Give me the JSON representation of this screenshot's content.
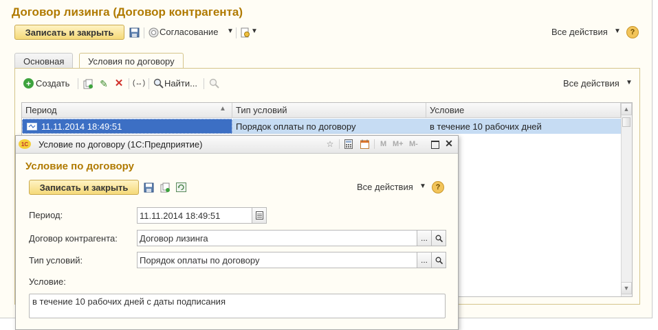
{
  "main": {
    "title": "Договор лизинга (Договор контрагента)",
    "toolbar": {
      "save_close": "Записать и закрыть",
      "approval": "Согласование",
      "all_actions": "Все действия"
    },
    "tabs": [
      {
        "label": "Основная"
      },
      {
        "label": "Условия по договору"
      }
    ],
    "subtoolbar": {
      "create": "Создать",
      "find": "Найти...",
      "all_actions": "Все действия"
    },
    "grid": {
      "columns": [
        "Период",
        "Тип условий",
        "Условие"
      ],
      "rows": [
        {
          "period": "11.11.2014 18:49:51",
          "type": "Порядок оплаты по договору",
          "condition": "в течение 10 рабочих дней"
        }
      ]
    }
  },
  "dialog": {
    "window_title": "Условие по договору (1С:Предприятие)",
    "window_buttons": [
      "M",
      "M+",
      "M-"
    ],
    "title": "Условие по договору",
    "toolbar": {
      "save_close": "Записать и закрыть",
      "all_actions": "Все действия"
    },
    "fields": {
      "period_label": "Период:",
      "period_value": "11.11.2014 18:49:51",
      "contract_label": "Договор контрагента:",
      "contract_value": "Договор лизинга",
      "type_label": "Тип условий:",
      "type_value": "Порядок оплаты по договору",
      "condition_label": "Условие:",
      "condition_value": "в течение 10 рабочих дней с даты подписания"
    },
    "ellipsis": "...",
    "logo": "1С"
  },
  "colors": {
    "title": "#b07a00",
    "selection": "#c6dcf3",
    "selected_cell": "#3c6fc4",
    "button_gold": "#f5d978",
    "dialog_bg": "#fffdf5"
  }
}
